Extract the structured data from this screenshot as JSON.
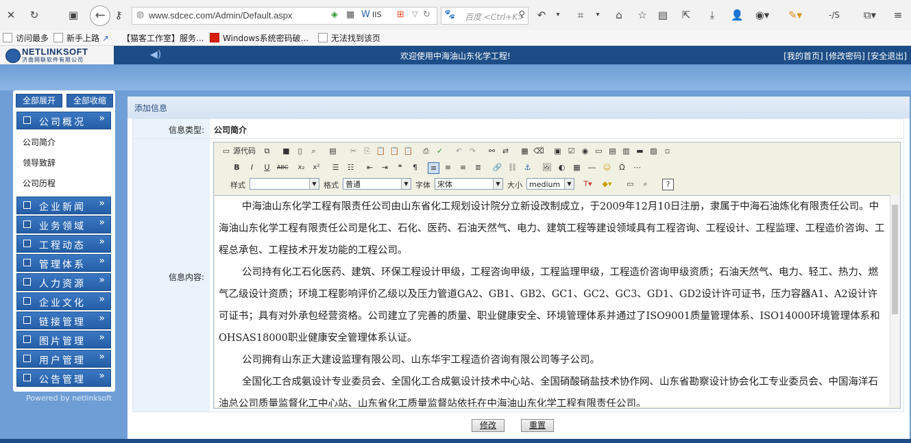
{
  "browser": {
    "url": "www.sdcec.com/Admin/Default.aspx",
    "search_placeholder": "百度 <Ctrl+K>"
  },
  "bookmarks": [
    {
      "label": "访问最多"
    },
    {
      "label": "新手上路"
    },
    {
      "label": "【猫客工作室】服务..."
    },
    {
      "label": "Windows系统密码破..."
    },
    {
      "label": "无法找到该页"
    }
  ],
  "header": {
    "logo": "NETLINKSOFT",
    "logo_sub": "济南网联软件有限公司",
    "welcome": "欢迎使用中海油山东化学工程!",
    "links": "[我的首页] [修改密码] [安全退出]"
  },
  "sidebar": {
    "expand_all": "全部展开",
    "collapse_all": "全部收缩",
    "menus": [
      {
        "label": "公司概况",
        "children": [
          "公司简介",
          "领导致辞",
          "公司历程"
        ]
      },
      {
        "label": "企业新闻"
      },
      {
        "label": "业务领域"
      },
      {
        "label": "工程动态"
      },
      {
        "label": "管理体系"
      },
      {
        "label": "人力资源"
      },
      {
        "label": "企业文化"
      },
      {
        "label": "链接管理"
      },
      {
        "label": "图片管理"
      },
      {
        "label": "用户管理"
      },
      {
        "label": "公告管理"
      }
    ],
    "powered": "Powered by netlinksoft"
  },
  "form": {
    "title": "添加信息",
    "type_label": "信息类型:",
    "type_value": "公司简介",
    "content_label": "信息内容:",
    "submit": "修改",
    "reset": "重置"
  },
  "editor": {
    "source_button": "源代码",
    "style_label": "样式",
    "style_value": "",
    "format_label": "格式",
    "format_value": "普通",
    "font_label": "字体",
    "font_value": "宋体",
    "size_label": "大小",
    "size_value": "medium",
    "paragraphs": [
      "中海油山东化学工程有限责任公司由山东省化工规划设计院分立新设改制成立，于2009年12月10日注册，隶属于中海石油炼化有限责任公司。中海油山东化学工程有限责任公司是化工、石化、医药、石油天然气、电力、建筑工程等建设领域具有工程咨询、工程设计、工程监理、工程造价咨询、工程总承包、工程技术开发功能的工程公司。",
      "公司持有化工石化医药、建筑、环保工程设计甲级，工程咨询甲级，工程监理甲级，工程造价咨询甲级资质；石油天然气、电力、轻工、热力、燃气乙级设计资质；环境工程影响评价乙级以及压力管道GA2、GB1、GB2、GC1、GC2、GC3、GD1、GD2设计许可证书，压力容器A1、A2设计许可证书；具有对外承包经营资格。公司建立了完善的质量、职业健康安全、环境管理体系并通过了ISO9001质量管理体系、ISO14000环境管理体系和OHSAS18000职业健康安全管理体系认证。",
      "公司拥有山东正大建设监理有限公司、山东华宇工程造价咨询有限公司等子公司。",
      "全国化工合成氨设计专业委员会、全国化工合成氨设计技术中心站、全国硝酸硝盐技术协作网、山东省勘察设计协会化工专业委员会、中国海洋石油总公司质量监督化工中心站、山东省化工质量监督站依托在中海油山东化学工程有限责任公司。"
    ]
  }
}
